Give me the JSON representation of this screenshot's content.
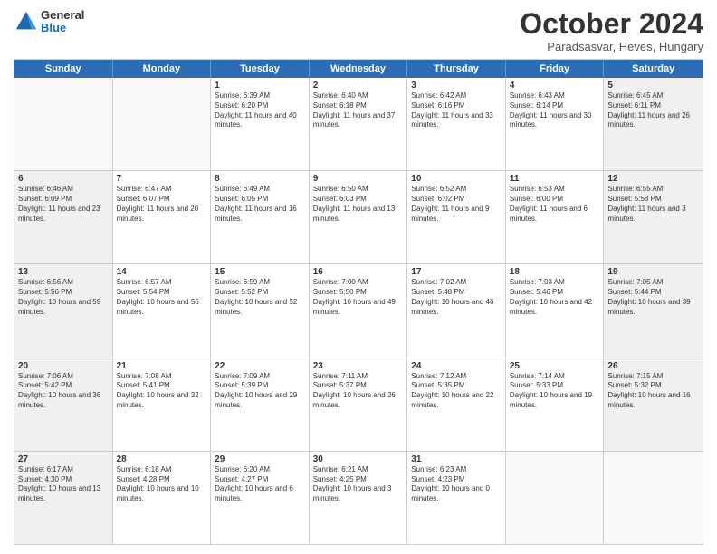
{
  "logo": {
    "general": "General",
    "blue": "Blue"
  },
  "header": {
    "month": "October 2024",
    "location": "Paradsasvar, Heves, Hungary"
  },
  "weekdays": [
    "Sunday",
    "Monday",
    "Tuesday",
    "Wednesday",
    "Thursday",
    "Friday",
    "Saturday"
  ],
  "rows": [
    [
      {
        "day": "",
        "sunrise": "",
        "sunset": "",
        "daylight": "",
        "empty": true
      },
      {
        "day": "",
        "sunrise": "",
        "sunset": "",
        "daylight": "",
        "empty": true
      },
      {
        "day": "1",
        "sunrise": "Sunrise: 6:39 AM",
        "sunset": "Sunset: 6:20 PM",
        "daylight": "Daylight: 11 hours and 40 minutes."
      },
      {
        "day": "2",
        "sunrise": "Sunrise: 6:40 AM",
        "sunset": "Sunset: 6:18 PM",
        "daylight": "Daylight: 11 hours and 37 minutes."
      },
      {
        "day": "3",
        "sunrise": "Sunrise: 6:42 AM",
        "sunset": "Sunset: 6:16 PM",
        "daylight": "Daylight: 11 hours and 33 minutes."
      },
      {
        "day": "4",
        "sunrise": "Sunrise: 6:43 AM",
        "sunset": "Sunset: 6:14 PM",
        "daylight": "Daylight: 11 hours and 30 minutes."
      },
      {
        "day": "5",
        "sunrise": "Sunrise: 6:45 AM",
        "sunset": "Sunset: 6:11 PM",
        "daylight": "Daylight: 11 hours and 26 minutes.",
        "shaded": true
      }
    ],
    [
      {
        "day": "6",
        "sunrise": "Sunrise: 6:46 AM",
        "sunset": "Sunset: 6:09 PM",
        "daylight": "Daylight: 11 hours and 23 minutes.",
        "shaded": true
      },
      {
        "day": "7",
        "sunrise": "Sunrise: 6:47 AM",
        "sunset": "Sunset: 6:07 PM",
        "daylight": "Daylight: 11 hours and 20 minutes."
      },
      {
        "day": "8",
        "sunrise": "Sunrise: 6:49 AM",
        "sunset": "Sunset: 6:05 PM",
        "daylight": "Daylight: 11 hours and 16 minutes."
      },
      {
        "day": "9",
        "sunrise": "Sunrise: 6:50 AM",
        "sunset": "Sunset: 6:03 PM",
        "daylight": "Daylight: 11 hours and 13 minutes."
      },
      {
        "day": "10",
        "sunrise": "Sunrise: 6:52 AM",
        "sunset": "Sunset: 6:02 PM",
        "daylight": "Daylight: 11 hours and 9 minutes."
      },
      {
        "day": "11",
        "sunrise": "Sunrise: 6:53 AM",
        "sunset": "Sunset: 6:00 PM",
        "daylight": "Daylight: 11 hours and 6 minutes."
      },
      {
        "day": "12",
        "sunrise": "Sunrise: 6:55 AM",
        "sunset": "Sunset: 5:58 PM",
        "daylight": "Daylight: 11 hours and 3 minutes.",
        "shaded": true
      }
    ],
    [
      {
        "day": "13",
        "sunrise": "Sunrise: 6:56 AM",
        "sunset": "Sunset: 5:56 PM",
        "daylight": "Daylight: 10 hours and 59 minutes.",
        "shaded": true
      },
      {
        "day": "14",
        "sunrise": "Sunrise: 6:57 AM",
        "sunset": "Sunset: 5:54 PM",
        "daylight": "Daylight: 10 hours and 56 minutes."
      },
      {
        "day": "15",
        "sunrise": "Sunrise: 6:59 AM",
        "sunset": "Sunset: 5:52 PM",
        "daylight": "Daylight: 10 hours and 52 minutes."
      },
      {
        "day": "16",
        "sunrise": "Sunrise: 7:00 AM",
        "sunset": "Sunset: 5:50 PM",
        "daylight": "Daylight: 10 hours and 49 minutes."
      },
      {
        "day": "17",
        "sunrise": "Sunrise: 7:02 AM",
        "sunset": "Sunset: 5:48 PM",
        "daylight": "Daylight: 10 hours and 46 minutes."
      },
      {
        "day": "18",
        "sunrise": "Sunrise: 7:03 AM",
        "sunset": "Sunset: 5:46 PM",
        "daylight": "Daylight: 10 hours and 42 minutes."
      },
      {
        "day": "19",
        "sunrise": "Sunrise: 7:05 AM",
        "sunset": "Sunset: 5:44 PM",
        "daylight": "Daylight: 10 hours and 39 minutes.",
        "shaded": true
      }
    ],
    [
      {
        "day": "20",
        "sunrise": "Sunrise: 7:06 AM",
        "sunset": "Sunset: 5:42 PM",
        "daylight": "Daylight: 10 hours and 36 minutes.",
        "shaded": true
      },
      {
        "day": "21",
        "sunrise": "Sunrise: 7:08 AM",
        "sunset": "Sunset: 5:41 PM",
        "daylight": "Daylight: 10 hours and 32 minutes."
      },
      {
        "day": "22",
        "sunrise": "Sunrise: 7:09 AM",
        "sunset": "Sunset: 5:39 PM",
        "daylight": "Daylight: 10 hours and 29 minutes."
      },
      {
        "day": "23",
        "sunrise": "Sunrise: 7:11 AM",
        "sunset": "Sunset: 5:37 PM",
        "daylight": "Daylight: 10 hours and 26 minutes."
      },
      {
        "day": "24",
        "sunrise": "Sunrise: 7:12 AM",
        "sunset": "Sunset: 5:35 PM",
        "daylight": "Daylight: 10 hours and 22 minutes."
      },
      {
        "day": "25",
        "sunrise": "Sunrise: 7:14 AM",
        "sunset": "Sunset: 5:33 PM",
        "daylight": "Daylight: 10 hours and 19 minutes."
      },
      {
        "day": "26",
        "sunrise": "Sunrise: 7:15 AM",
        "sunset": "Sunset: 5:32 PM",
        "daylight": "Daylight: 10 hours and 16 minutes.",
        "shaded": true
      }
    ],
    [
      {
        "day": "27",
        "sunrise": "Sunrise: 6:17 AM",
        "sunset": "Sunset: 4:30 PM",
        "daylight": "Daylight: 10 hours and 13 minutes.",
        "shaded": true
      },
      {
        "day": "28",
        "sunrise": "Sunrise: 6:18 AM",
        "sunset": "Sunset: 4:28 PM",
        "daylight": "Daylight: 10 hours and 10 minutes."
      },
      {
        "day": "29",
        "sunrise": "Sunrise: 6:20 AM",
        "sunset": "Sunset: 4:27 PM",
        "daylight": "Daylight: 10 hours and 6 minutes."
      },
      {
        "day": "30",
        "sunrise": "Sunrise: 6:21 AM",
        "sunset": "Sunset: 4:25 PM",
        "daylight": "Daylight: 10 hours and 3 minutes."
      },
      {
        "day": "31",
        "sunrise": "Sunrise: 6:23 AM",
        "sunset": "Sunset: 4:23 PM",
        "daylight": "Daylight: 10 hours and 0 minutes."
      },
      {
        "day": "",
        "sunrise": "",
        "sunset": "",
        "daylight": "",
        "empty": true
      },
      {
        "day": "",
        "sunrise": "",
        "sunset": "",
        "daylight": "",
        "empty": true,
        "shaded": true
      }
    ]
  ]
}
